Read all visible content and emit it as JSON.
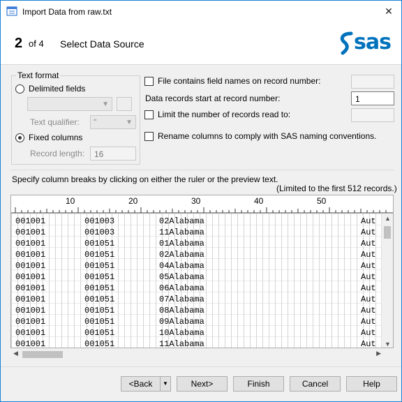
{
  "window": {
    "title": "Import Data from raw.txt",
    "close_glyph": "✕"
  },
  "wizard": {
    "step": "2",
    "of": "of 4",
    "title": "Select Data Source",
    "logo_text": "sas"
  },
  "text_format": {
    "legend": "Text format",
    "delimited_label": "Delimited fields",
    "qualifier_label": "Text qualifier:",
    "qualifier_value": "\"",
    "fixed_label": "Fixed columns",
    "record_length_label": "Record length:",
    "record_length_value": "16"
  },
  "options": {
    "field_names_label": "File contains field names on record number:",
    "data_start_label": "Data records start at record number:",
    "data_start_value": "1",
    "limit_label": "Limit the number of records read to:",
    "rename_label": "Rename columns to comply with SAS naming conventions."
  },
  "preview": {
    "instructions": "Specify column breaks by clicking on either the ruler or the preview text.",
    "limit_note": "(Limited to the first 512 records.)",
    "ruler_labels": [
      "10",
      "20",
      "30",
      "40",
      "50"
    ],
    "rows": [
      [
        "001001",
        "001003",
        "02Alabama",
        "Aut"
      ],
      [
        "001001",
        "001003",
        "11Alabama",
        "Aut"
      ],
      [
        "001001",
        "001051",
        "01Alabama",
        "Aut"
      ],
      [
        "001001",
        "001051",
        "02Alabama",
        "Aut"
      ],
      [
        "001001",
        "001051",
        "04Alabama",
        "Aut"
      ],
      [
        "001001",
        "001051",
        "05Alabama",
        "Aut"
      ],
      [
        "001001",
        "001051",
        "06Alabama",
        "Aut"
      ],
      [
        "001001",
        "001051",
        "07Alabama",
        "Aut"
      ],
      [
        "001001",
        "001051",
        "08Alabama",
        "Aut"
      ],
      [
        "001001",
        "001051",
        "09Alabama",
        "Aut"
      ],
      [
        "001001",
        "001051",
        "10Alabama",
        "Aut"
      ],
      [
        "001001",
        "001051",
        "11Alabama",
        "Aut"
      ]
    ]
  },
  "buttons": {
    "back": "<Back",
    "next": "Next>",
    "finish": "Finish",
    "cancel": "Cancel",
    "help": "Help"
  },
  "colors": {
    "accent": "#1883d7",
    "sas_blue": "#0072bc"
  }
}
